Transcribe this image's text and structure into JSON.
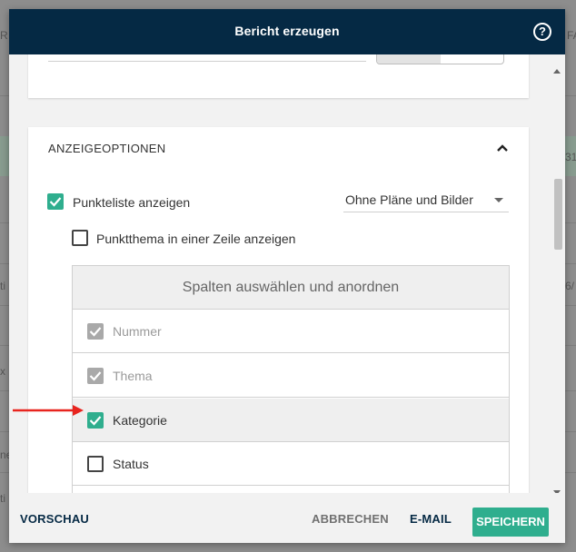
{
  "header": {
    "title": "Bericht erzeugen",
    "help_label": "?"
  },
  "top_card": {
    "field_value_partial": ""
  },
  "section": {
    "title": "ANZEIGEOPTIONEN",
    "show_points": {
      "label": "Punkteliste anzeigen",
      "checked": true
    },
    "image_option": {
      "value": "Ohne Pläne und Bilder"
    },
    "single_line": {
      "label": "Punktthema in einer Zeile anzeigen",
      "checked": false
    },
    "columns": {
      "heading": "Spalten auswählen und anordnen",
      "items": [
        {
          "label": "Nummer",
          "state": "disabled-checked"
        },
        {
          "label": "Thema",
          "state": "disabled-checked"
        },
        {
          "label": "Kategorie",
          "state": "checked"
        },
        {
          "label": "Status",
          "state": "unchecked"
        },
        {
          "label": "",
          "state": "unchecked"
        }
      ]
    }
  },
  "footer": {
    "preview": "VORSCHAU",
    "cancel": "ABBRECHEN",
    "email": "E-MAIL",
    "save": "SPEICHERN"
  },
  "background": {
    "left_fragments": [
      "ti",
      "x",
      "ne",
      "ti"
    ],
    "right_fragments": [
      "FA",
      "31/",
      "6/"
    ],
    "top_left": "R"
  },
  "colors": {
    "header_bg": "#052944",
    "accent": "#2fae8e",
    "annotation_arrow": "#e8251f"
  }
}
